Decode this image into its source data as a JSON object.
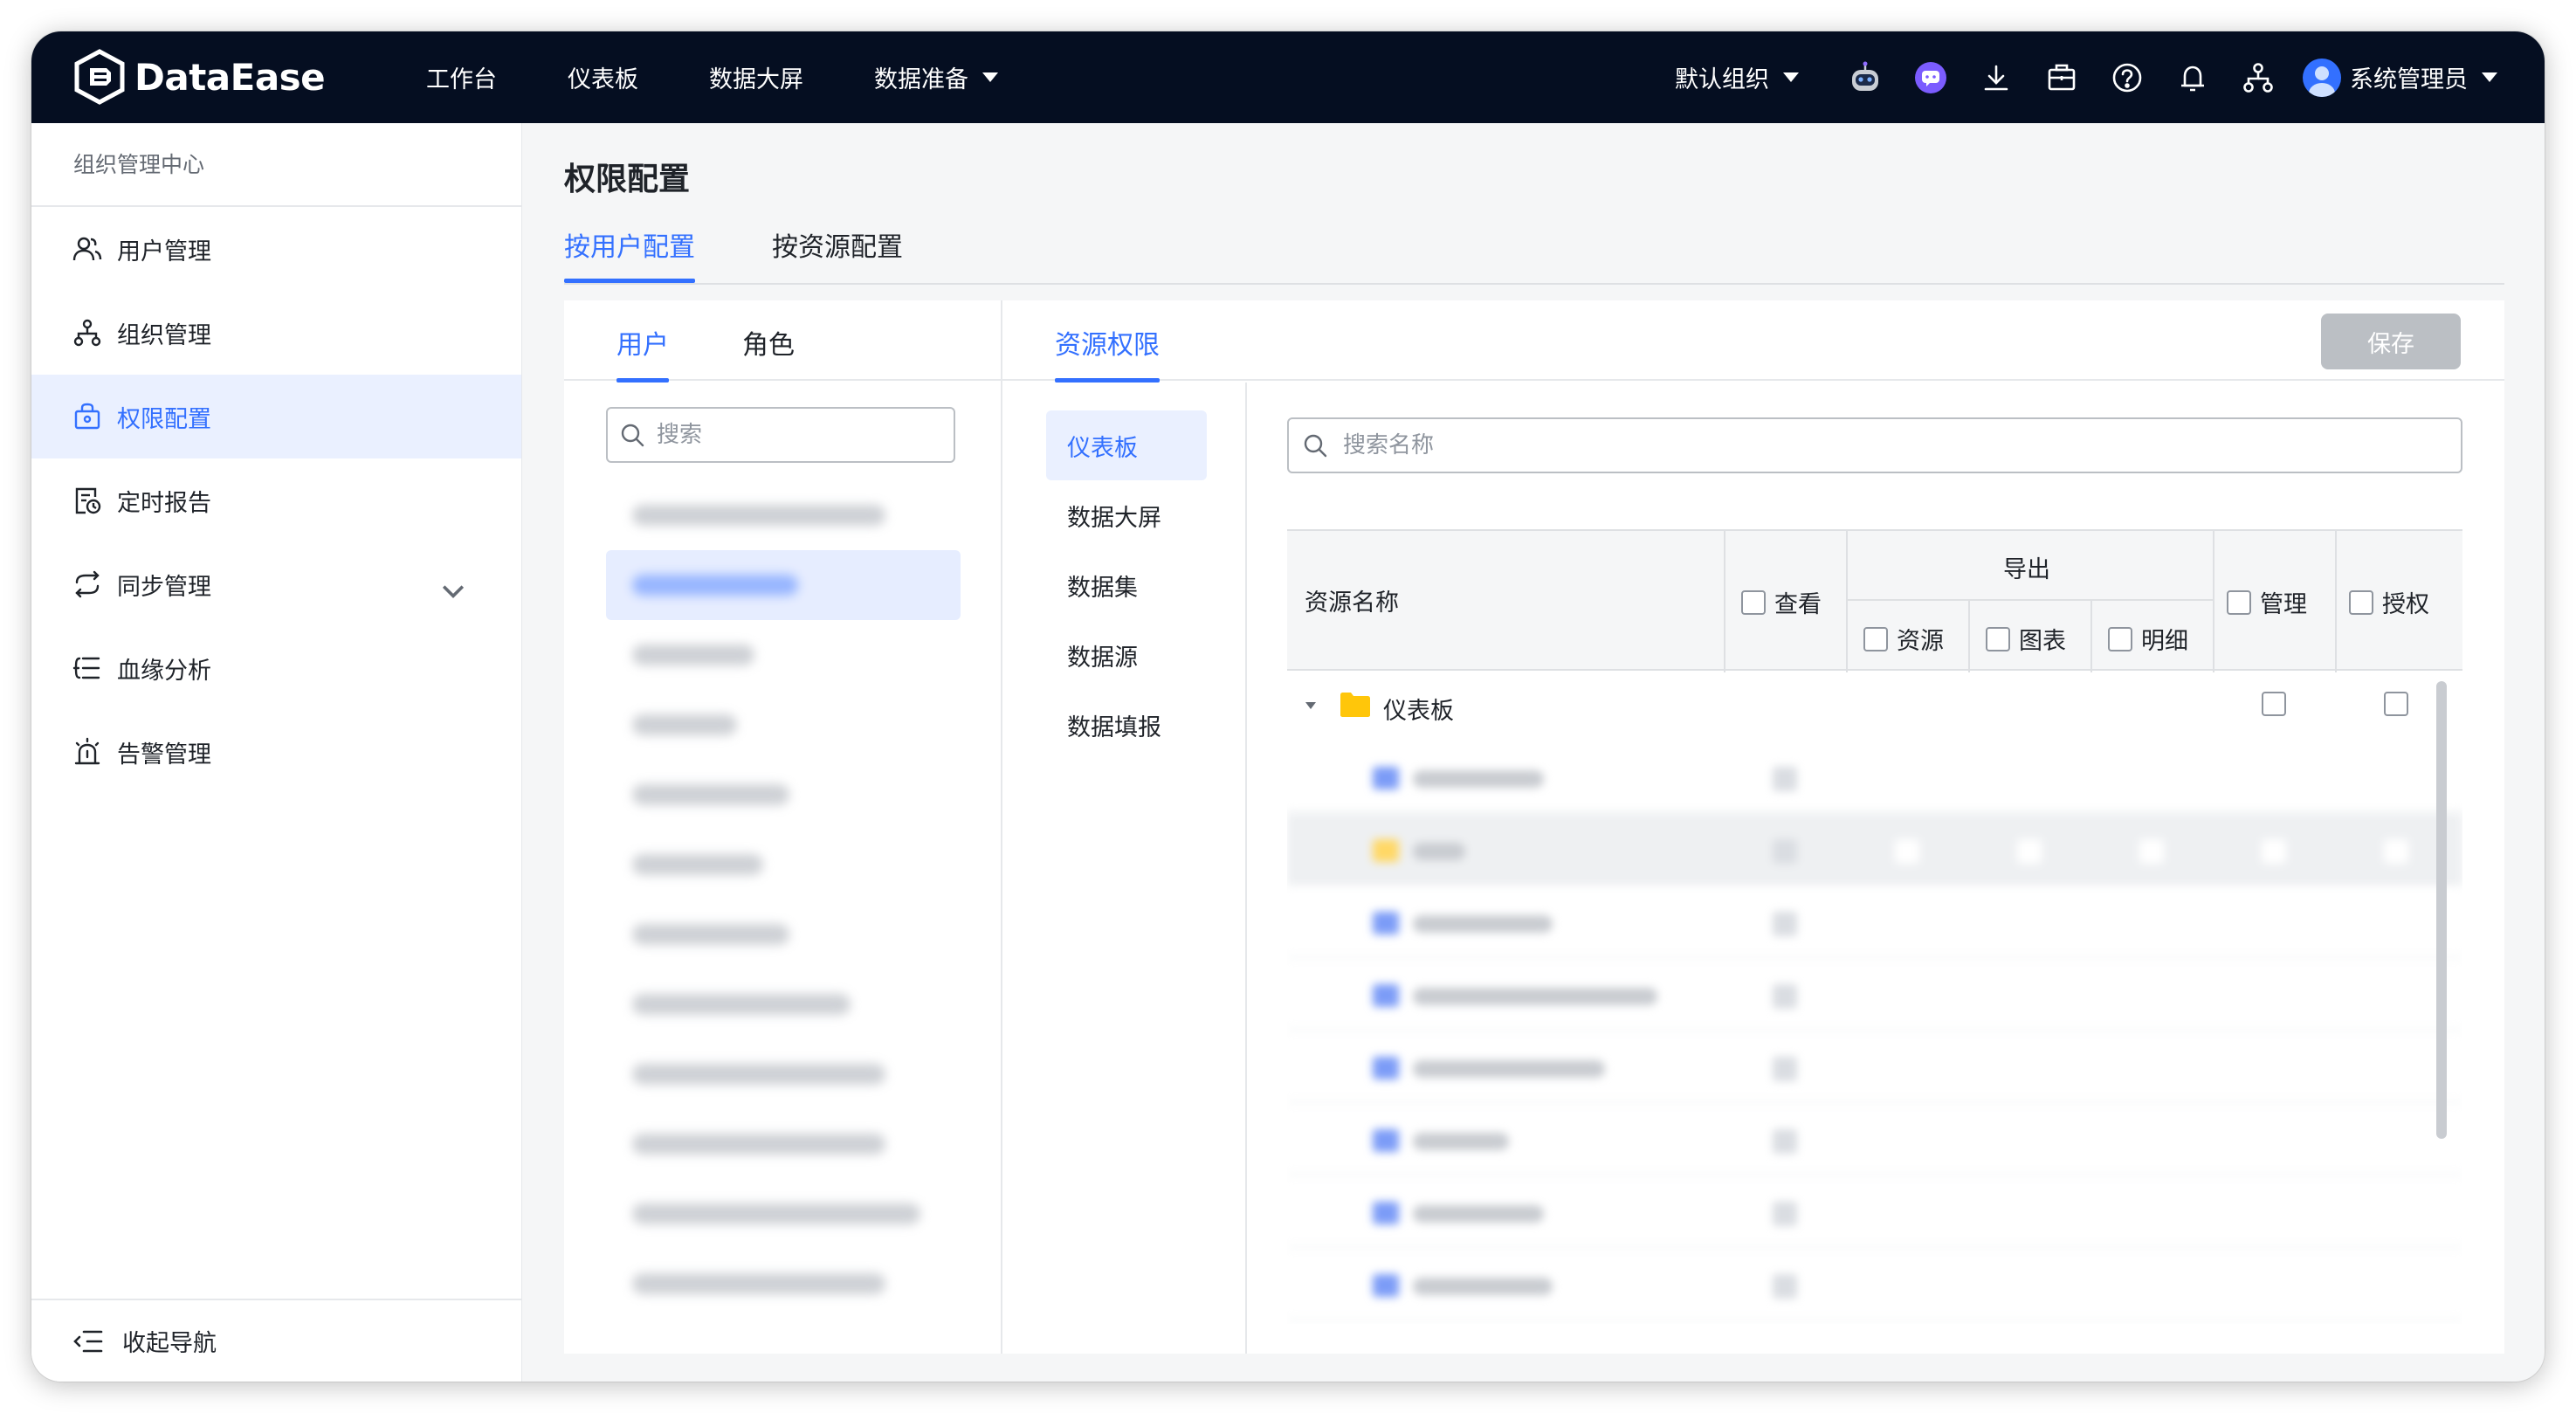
{
  "app": {
    "logo_text": "DataEase",
    "nav": [
      "工作台",
      "仪表板",
      "数据大屏",
      "数据准备"
    ],
    "org": "默认组织",
    "user": "系统管理员"
  },
  "sidebar": {
    "title": "组织管理中心",
    "items": [
      {
        "label": "用户管理",
        "icon": "users-icon"
      },
      {
        "label": "组织管理",
        "icon": "org-tree-icon"
      },
      {
        "label": "权限配置",
        "icon": "lock-case-icon"
      },
      {
        "label": "定时报告",
        "icon": "report-clock-icon"
      },
      {
        "label": "同步管理",
        "icon": "sync-icon"
      },
      {
        "label": "血缘分析",
        "icon": "lineage-icon"
      },
      {
        "label": "告警管理",
        "icon": "alarm-icon"
      }
    ],
    "active_index": 2,
    "collapse_label": "收起导航"
  },
  "page": {
    "title": "权限配置",
    "tabs": [
      "按用户配置",
      "按资源配置"
    ],
    "active_tab": 0
  },
  "user_panel": {
    "tabs": [
      "用户",
      "角色"
    ],
    "active_tab": 0,
    "search_placeholder": "搜索"
  },
  "resource_panel": {
    "tab": "资源权限",
    "save_label": "保存",
    "menu": [
      "仪表板",
      "数据大屏",
      "数据集",
      "数据源",
      "数据填报"
    ],
    "active_menu": 0,
    "search_placeholder": "搜索名称",
    "table": {
      "col_name": "资源名称",
      "col_view": "查看",
      "col_export": "导出",
      "export_sub": [
        "资源",
        "图表",
        "明细"
      ],
      "col_manage": "管理",
      "col_grant": "授权",
      "root_folder": "仪表板"
    }
  },
  "colors": {
    "topbar": "#050e21",
    "accent": "#3370ff",
    "folder": "#ffc60a"
  }
}
